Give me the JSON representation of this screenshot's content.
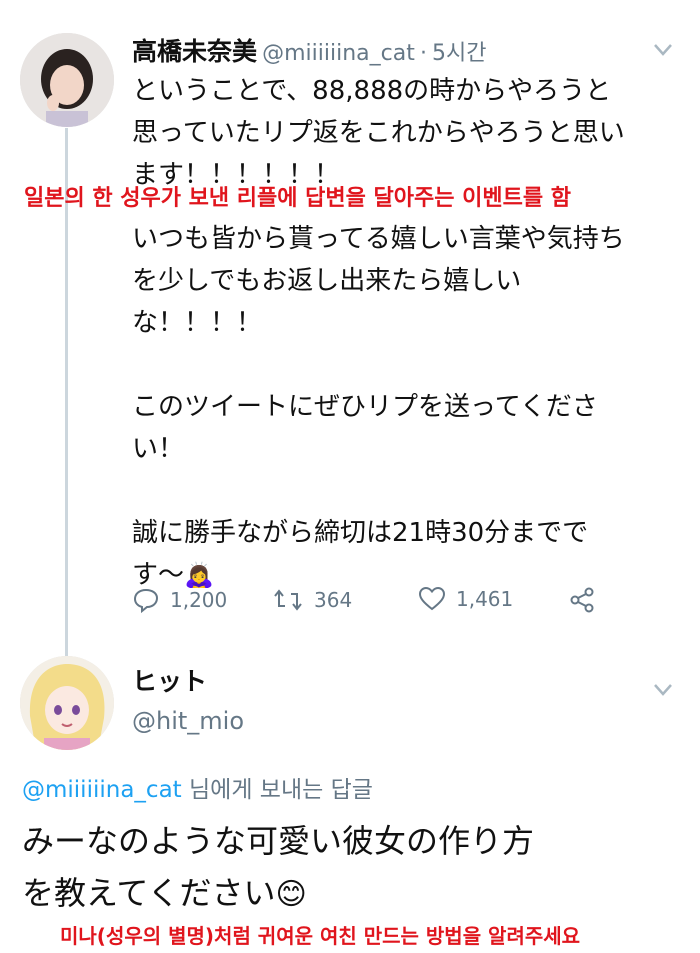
{
  "tweet": {
    "author_name": "高橋未奈美",
    "handle": "@miiiiiina_cat",
    "separator": "·",
    "time": "5시간",
    "text_lines_1": "ということで、88,888の時からやろうと\n思っていたリプ返をこれからやろうと思い\nます！！！！！！",
    "korean_caption_1": "일본의 한 성우가 보낸 리플에 답변을 달아주는 이벤트를 함",
    "text_lines_2": "いつも皆から貰ってる嬉しい言葉や気持ち\nを少しでもお返し出来たら嬉しい\nな！！！！\n\nこのツイートにぜひリプを送ってくださ\nい！\n\n誠に勝手ながら締切は21時30分までで\nす〜",
    "emoji": "🙇‍♀️",
    "actions": {
      "reply_count": "1,200",
      "retweet_count": "364",
      "like_count": "1,461"
    }
  },
  "reply": {
    "author_name": "ヒット",
    "handle": "@hit_mio",
    "replying_to_handle": "@miiiiiina_cat",
    "replying_to_suffix": " 님에게 보내는 답글",
    "text": "みーなのような可愛い彼女の作り方\nを教えてください",
    "emoji": "😊",
    "korean_caption_2": "미나(성우의 별명)처럼 귀여운 여친 만드는 방법을 알려주세요"
  },
  "colors": {
    "accent": "#1da1f2",
    "caption_red": "#e0151d",
    "muted": "#657786"
  }
}
